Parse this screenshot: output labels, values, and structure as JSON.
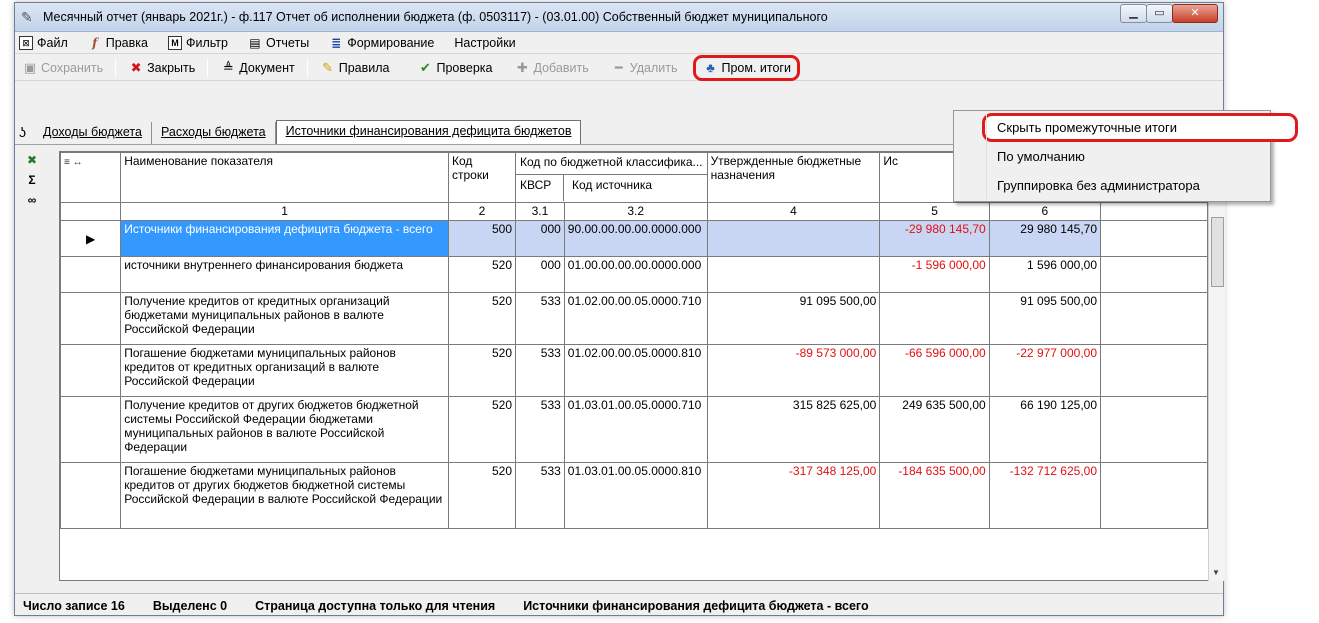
{
  "window": {
    "title": "Месячный отчет (январь 2021г.) - ф.117 Отчет об исполнении бюджета (ф. 0503117)  -  (03.01.00) Собственный бюджет муниципального",
    "minimize": "▁",
    "maximize": "▭",
    "close": "✕"
  },
  "menu": [
    {
      "label": "Файл",
      "icon": "⊠"
    },
    {
      "label": "Правка",
      "icon": "f"
    },
    {
      "label": "Фильтр",
      "icon": "M"
    },
    {
      "label": "Отчеты",
      "icon": "▤"
    },
    {
      "label": "Формирование",
      "icon": "≣"
    },
    {
      "label": "Настройки",
      "icon": ""
    }
  ],
  "toolbar": {
    "save": "Сохранить",
    "close": "Закрыть",
    "document": "Документ",
    "rules": "Правила",
    "check": "Проверка",
    "add": "Добавить",
    "delete": "Удалить",
    "subtotals": "Пром. итоги"
  },
  "tabs": [
    "Доходы бюджета",
    "Расходы бюджета",
    "Источники финансирования дефицита бюджетов"
  ],
  "context_menu": {
    "hide": "Скрыть промежуточные итоги",
    "default": "По умолчанию",
    "group": "Группировка без администратора"
  },
  "table": {
    "headers": {
      "name": "Наименование показателя",
      "code": "Код строки",
      "budget_class": "Код по бюджетной классифика...",
      "kvsr": "КВСР",
      "source_code": "Код источника",
      "approved": "Утвержденные бюджетные назначения",
      "executed": "Ис"
    },
    "col_numbers": [
      "1",
      "2",
      "3.1",
      "3.2",
      "4",
      "5",
      "6"
    ],
    "rows": [
      {
        "name": "Источники финансирования дефицита бюджета - всего",
        "code": "500",
        "kvsr": "000",
        "src": "90.00.00.00.00.0000.000",
        "c4": "",
        "c5": "-29 980 145,70",
        "c6": "29 980 145,70"
      },
      {
        "name": "источники внутреннего финансирования бюджета",
        "code": "520",
        "kvsr": "000",
        "src": "01.00.00.00.00.0000.000",
        "c4": "",
        "c5": "-1 596 000,00",
        "c6": "1 596 000,00"
      },
      {
        "name": "Получение кредитов от кредитных организаций бюджетами муниципальных районов в валюте Российской Федерации",
        "code": "520",
        "kvsr": "533",
        "src": "01.02.00.00.05.0000.710",
        "c4": "91 095 500,00",
        "c5": "",
        "c6": "91 095 500,00"
      },
      {
        "name": "Погашение бюджетами муниципальных районов кредитов от кредитных организаций в валюте Российской Федерации",
        "code": "520",
        "kvsr": "533",
        "src": "01.02.00.00.05.0000.810",
        "c4": "-89 573 000,00",
        "c5": "-66 596 000,00",
        "c6": "-22 977 000,00"
      },
      {
        "name": "Получение кредитов от других бюджетов бюджетной системы Российской Федерации бюджетами муниципальных районов в валюте Российской Федерации",
        "code": "520",
        "kvsr": "533",
        "src": "01.03.01.00.05.0000.710",
        "c4": "315 825 625,00",
        "c5": "249 635 500,00",
        "c6": "66 190 125,00"
      },
      {
        "name": "Погашение бюджетами муниципальных районов кредитов от других бюджетов бюджетной системы Российской Федерации в валюте Российской Федерации",
        "code": "520",
        "kvsr": "533",
        "src": "01.03.01.00.05.0000.810",
        "c4": "-317 348 125,00",
        "c5": "-184 635 500,00",
        "c6": "-132 712 625,00"
      }
    ]
  },
  "status": {
    "records": "Число записе 16",
    "selected": "Выделенс 0",
    "readonly": "Страница доступна только для чтения",
    "current": "Источники финансирования дефицита бюджета - всего"
  },
  "colors": {
    "negative": "#e01010",
    "selection": "#3399ff",
    "highlight_ring": "#e01919"
  }
}
